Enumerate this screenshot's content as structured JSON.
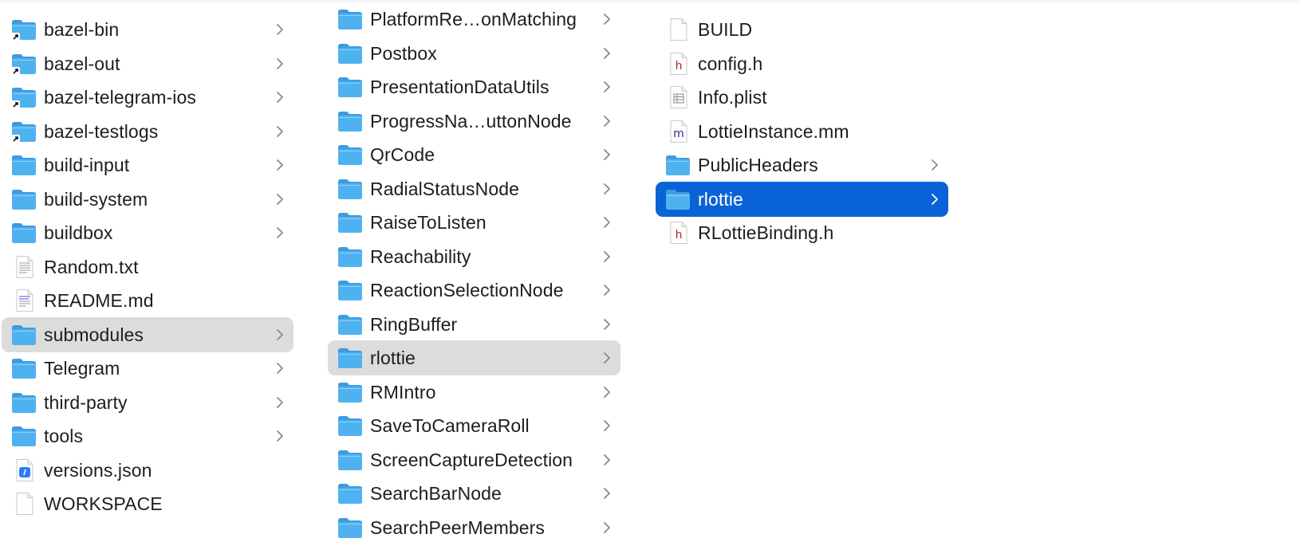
{
  "window": {
    "accent_color": "#0a63d6",
    "selection_gray": "#dcdcdc",
    "folder_color": "#4fb2f0"
  },
  "columns": [
    {
      "items": [
        {
          "name": "bazel-bin",
          "kind": "folder-alias",
          "icon": "folder-alias-icon",
          "has_children": true,
          "selected": "none"
        },
        {
          "name": "bazel-out",
          "kind": "folder-alias",
          "icon": "folder-alias-icon",
          "has_children": true,
          "selected": "none"
        },
        {
          "name": "bazel-telegram-ios",
          "kind": "folder-alias",
          "icon": "folder-alias-icon",
          "has_children": true,
          "selected": "none"
        },
        {
          "name": "bazel-testlogs",
          "kind": "folder-alias",
          "icon": "folder-alias-icon",
          "has_children": true,
          "selected": "none"
        },
        {
          "name": "build-input",
          "kind": "folder",
          "icon": "folder-icon",
          "has_children": true,
          "selected": "none"
        },
        {
          "name": "build-system",
          "kind": "folder",
          "icon": "folder-icon",
          "has_children": true,
          "selected": "none"
        },
        {
          "name": "buildbox",
          "kind": "folder",
          "icon": "folder-icon",
          "has_children": true,
          "selected": "none"
        },
        {
          "name": "Random.txt",
          "kind": "text",
          "icon": "text-file-icon",
          "has_children": false,
          "selected": "none"
        },
        {
          "name": "README.md",
          "kind": "markdown",
          "icon": "markdown-file-icon",
          "has_children": false,
          "selected": "none"
        },
        {
          "name": "submodules",
          "kind": "folder",
          "icon": "folder-icon",
          "has_children": true,
          "selected": "gray"
        },
        {
          "name": "Telegram",
          "kind": "folder",
          "icon": "folder-icon",
          "has_children": true,
          "selected": "none"
        },
        {
          "name": "third-party",
          "kind": "folder",
          "icon": "folder-icon",
          "has_children": true,
          "selected": "none"
        },
        {
          "name": "tools",
          "kind": "folder",
          "icon": "folder-icon",
          "has_children": true,
          "selected": "none"
        },
        {
          "name": "versions.json",
          "kind": "json",
          "icon": "json-file-icon",
          "has_children": false,
          "selected": "none"
        },
        {
          "name": "WORKSPACE",
          "kind": "file",
          "icon": "blank-file-icon",
          "has_children": false,
          "selected": "none"
        }
      ]
    },
    {
      "items": [
        {
          "name": "PlatformRe…onMatching",
          "kind": "folder",
          "icon": "folder-icon",
          "has_children": true,
          "selected": "none"
        },
        {
          "name": "Postbox",
          "kind": "folder",
          "icon": "folder-icon",
          "has_children": true,
          "selected": "none"
        },
        {
          "name": "PresentationDataUtils",
          "kind": "folder",
          "icon": "folder-icon",
          "has_children": true,
          "selected": "none"
        },
        {
          "name": "ProgressNa…uttonNode",
          "kind": "folder",
          "icon": "folder-icon",
          "has_children": true,
          "selected": "none"
        },
        {
          "name": "QrCode",
          "kind": "folder",
          "icon": "folder-icon",
          "has_children": true,
          "selected": "none"
        },
        {
          "name": "RadialStatusNode",
          "kind": "folder",
          "icon": "folder-icon",
          "has_children": true,
          "selected": "none"
        },
        {
          "name": "RaiseToListen",
          "kind": "folder",
          "icon": "folder-icon",
          "has_children": true,
          "selected": "none"
        },
        {
          "name": "Reachability",
          "kind": "folder",
          "icon": "folder-icon",
          "has_children": true,
          "selected": "none"
        },
        {
          "name": "ReactionSelectionNode",
          "kind": "folder",
          "icon": "folder-icon",
          "has_children": true,
          "selected": "none"
        },
        {
          "name": "RingBuffer",
          "kind": "folder",
          "icon": "folder-icon",
          "has_children": true,
          "selected": "none"
        },
        {
          "name": "rlottie",
          "kind": "folder",
          "icon": "folder-icon",
          "has_children": true,
          "selected": "gray"
        },
        {
          "name": "RMIntro",
          "kind": "folder",
          "icon": "folder-icon",
          "has_children": true,
          "selected": "none"
        },
        {
          "name": "SaveToCameraRoll",
          "kind": "folder",
          "icon": "folder-icon",
          "has_children": true,
          "selected": "none"
        },
        {
          "name": "ScreenCaptureDetection",
          "kind": "folder",
          "icon": "folder-icon",
          "has_children": true,
          "selected": "none"
        },
        {
          "name": "SearchBarNode",
          "kind": "folder",
          "icon": "folder-icon",
          "has_children": true,
          "selected": "none"
        },
        {
          "name": "SearchPeerMembers",
          "kind": "folder",
          "icon": "folder-icon",
          "has_children": true,
          "selected": "none"
        }
      ]
    },
    {
      "items": [
        {
          "name": "BUILD",
          "kind": "file",
          "icon": "blank-file-icon",
          "has_children": false,
          "selected": "none"
        },
        {
          "name": "config.h",
          "kind": "header",
          "icon": "header-file-icon",
          "has_children": false,
          "selected": "none"
        },
        {
          "name": "Info.plist",
          "kind": "plist",
          "icon": "plist-file-icon",
          "has_children": false,
          "selected": "none"
        },
        {
          "name": "LottieInstance.mm",
          "kind": "objcpp",
          "icon": "objcpp-file-icon",
          "has_children": false,
          "selected": "none"
        },
        {
          "name": "PublicHeaders",
          "kind": "folder",
          "icon": "folder-icon",
          "has_children": true,
          "selected": "none"
        },
        {
          "name": "rlottie",
          "kind": "folder",
          "icon": "folder-icon",
          "has_children": true,
          "selected": "blue"
        },
        {
          "name": "RLottieBinding.h",
          "kind": "header",
          "icon": "header-file-icon",
          "has_children": false,
          "selected": "none"
        }
      ]
    },
    {
      "items": []
    }
  ]
}
